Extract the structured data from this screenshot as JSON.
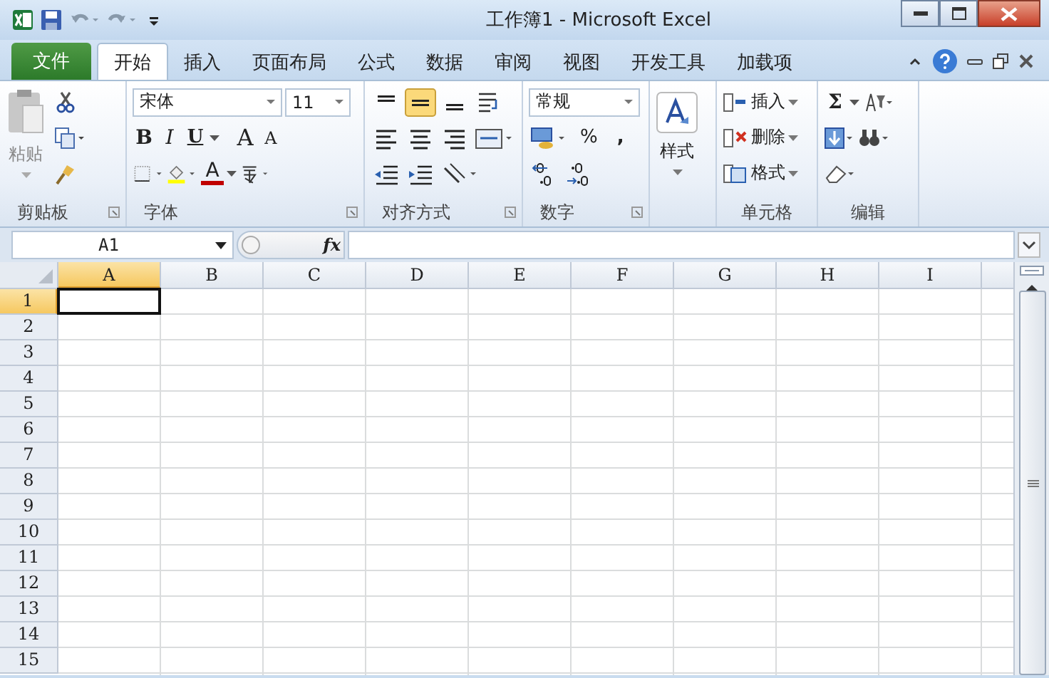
{
  "window": {
    "title": "工作簿1 - Microsoft Excel"
  },
  "file_tab": {
    "label": "文件"
  },
  "tabs": [
    {
      "label": "开始",
      "selected": true
    },
    {
      "label": "插入",
      "selected": false
    },
    {
      "label": "页面布局",
      "selected": false
    },
    {
      "label": "公式",
      "selected": false
    },
    {
      "label": "数据",
      "selected": false
    },
    {
      "label": "审阅",
      "selected": false
    },
    {
      "label": "视图",
      "selected": false
    },
    {
      "label": "开发工具",
      "selected": false
    },
    {
      "label": "加载项",
      "selected": false
    }
  ],
  "ribbon": {
    "clipboard": {
      "paste": "粘贴",
      "label": "剪贴板"
    },
    "font": {
      "font_name": "宋体",
      "font_size": "11",
      "bold": "B",
      "italic": "I",
      "underline": "U",
      "grow": "A",
      "shrink": "A",
      "font_color_letter": "A",
      "label": "字体"
    },
    "alignment": {
      "vertical": [
        {
          "kind": "top",
          "selected": false
        },
        {
          "kind": "middle",
          "selected": true
        },
        {
          "kind": "bottom",
          "selected": false
        }
      ],
      "label": "对齐方式"
    },
    "number": {
      "format": "常规",
      "percent": "%",
      "comma": ",",
      "label": "数字"
    },
    "styles": {
      "button": "样式"
    },
    "cells": {
      "insert": "插入",
      "delete": "删除",
      "format": "格式",
      "label": "单元格"
    },
    "editing": {
      "sum": "Σ",
      "label": "编辑"
    }
  },
  "formula_bar": {
    "name_box": "A1",
    "fx": "fx"
  },
  "sheet": {
    "columns": [
      {
        "label": "A",
        "selected": true
      },
      {
        "label": "B",
        "selected": false
      },
      {
        "label": "C",
        "selected": false
      },
      {
        "label": "D",
        "selected": false
      },
      {
        "label": "E",
        "selected": false
      },
      {
        "label": "F",
        "selected": false
      },
      {
        "label": "G",
        "selected": false
      },
      {
        "label": "H",
        "selected": false
      },
      {
        "label": "I",
        "selected": false
      }
    ],
    "rows": [
      {
        "label": "1",
        "selected": true
      },
      {
        "label": "2",
        "selected": false
      },
      {
        "label": "3",
        "selected": false
      },
      {
        "label": "4",
        "selected": false
      },
      {
        "label": "5",
        "selected": false
      },
      {
        "label": "6",
        "selected": false
      },
      {
        "label": "7",
        "selected": false
      },
      {
        "label": "8",
        "selected": false
      },
      {
        "label": "9",
        "selected": false
      },
      {
        "label": "10",
        "selected": false
      },
      {
        "label": "11",
        "selected": false
      },
      {
        "label": "12",
        "selected": false
      },
      {
        "label": "13",
        "selected": false
      },
      {
        "label": "14",
        "selected": false
      },
      {
        "label": "15",
        "selected": false
      }
    ]
  }
}
